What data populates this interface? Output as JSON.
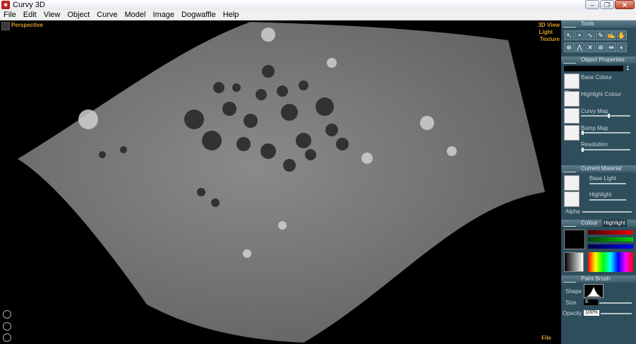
{
  "window": {
    "title": "Curvy 3D",
    "controls": [
      "–",
      "❐",
      "✕"
    ]
  },
  "menu": [
    "File",
    "Edit",
    "View",
    "Object",
    "Curve",
    "Model",
    "Image",
    "Dogwaffle",
    "Help"
  ],
  "viewport": {
    "label": "Perspective",
    "modes": [
      "3D View",
      "Light",
      "Texture"
    ],
    "footer": "File"
  },
  "panel": {
    "tools_title": "Tools",
    "object_properties": {
      "title": "Object Properties",
      "number": "1",
      "base_colour": "Base Colour",
      "highlight_colour": "Highlight Colour",
      "curvy_map": "Curvy Map",
      "bump_map": "Bump Map",
      "resolution": "Resolution"
    },
    "current_material": {
      "title": "Current Material",
      "base_light": "Base Light",
      "highlight": "Highlight",
      "alpha": "Alpha"
    },
    "colour": {
      "title": "Colour",
      "tab": "Highlight"
    },
    "paint_brush": {
      "title": "Paint Brush",
      "shape": "Shape",
      "size": "Size",
      "size_value": "8.",
      "opacity": "Opacity",
      "opacity_value": "100%"
    }
  },
  "colors": {
    "panel": "#2e4e5c",
    "header": "#4e6e7c",
    "accent_label": "#d89a2a"
  }
}
